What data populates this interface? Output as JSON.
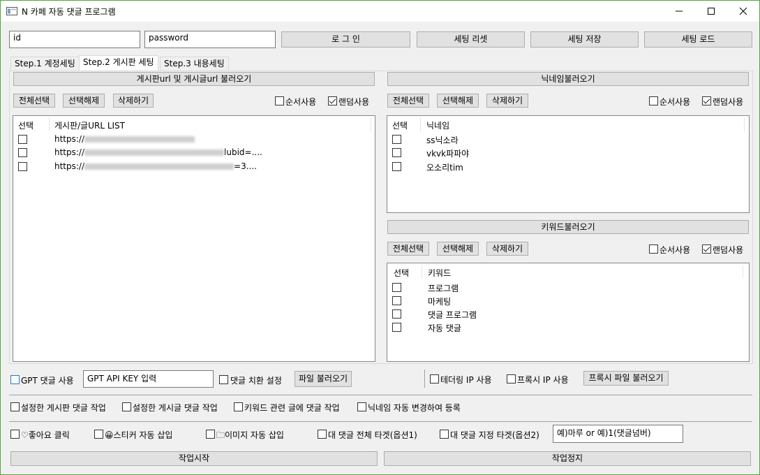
{
  "window": {
    "title": "N 카페 자동 댓글 프로그램"
  },
  "login": {
    "id_value": "id",
    "password_value": "password",
    "login_btn": "로 그 인",
    "reset_btn": "세팅 리셋",
    "save_btn": "세팅 저장",
    "load_btn": "세팅 로드"
  },
  "tabs": [
    "Step.1 계정세팅",
    "Step.2 게시판 세팅",
    "Step.3 내용세팅"
  ],
  "board": {
    "header": "게시판url 및 게시글url 불러오기",
    "select_all": "전체선택",
    "deselect": "선택해제",
    "delete": "삭제하기",
    "order_use": "순서사용",
    "random_use": "랜덤사용",
    "col_select": "선택",
    "col_url": "게시판/글URL LIST",
    "rows": [
      {
        "prefix": "https://",
        "suffix": ""
      },
      {
        "prefix": "https://",
        "suffix": "lubid=...."
      },
      {
        "prefix": "https://",
        "suffix": "=3...."
      }
    ]
  },
  "nickname": {
    "header": "닉네임불러오기",
    "select_all": "전체선택",
    "deselect": "선택해제",
    "delete": "삭제하기",
    "order_use": "순서사용",
    "random_use": "랜덤사용",
    "col_select": "선택",
    "col_name": "닉네임",
    "rows": [
      "ss닉소라",
      "vkvk파파야",
      "오소리tim"
    ]
  },
  "keyword": {
    "header": "키워드불러오기",
    "select_all": "전체선택",
    "deselect": "선택해제",
    "delete": "삭제하기",
    "order_use": "순서사용",
    "random_use": "랜덤사용",
    "col_select": "선택",
    "col_keyword": "키워드",
    "rows": [
      "프로그램",
      "마케팅",
      "댓글 프로그램",
      "자동 댓글"
    ]
  },
  "options": {
    "gpt_use": "GPT 댓글 사용",
    "gpt_key_value": "GPT API KEY 입력",
    "replace_setting": "댓글 치환 설정",
    "file_load": "파일 불러오기",
    "tethering_ip": "테더링 IP 사용",
    "proxy_ip": "프록시 IP 사용",
    "proxy_file_load": "프록시 파일 불러오기",
    "board_comment": "설정한 게시판 댓글 작업",
    "post_comment": "설정한 게시글 댓글 작업",
    "keyword_comment": "키워드 관련 글에 댓글 작업",
    "nick_change": "닉네임 자동 변경하여 등록",
    "like_click": "♡좋아요 클릭",
    "sticker_insert": "😀스티커 자동 삽입",
    "image_insert": "🗀이미지 자동 삽입",
    "reply_all_target": "대 댓글 전체 타겟(옵션1)",
    "reply_specific_target": "대 댓글 지정 타겟(옵션2)",
    "reply_input_value": "예)마루 or 예)1(댓글넘버)"
  },
  "actions": {
    "start": "작업시작",
    "stop": "작업정지"
  }
}
